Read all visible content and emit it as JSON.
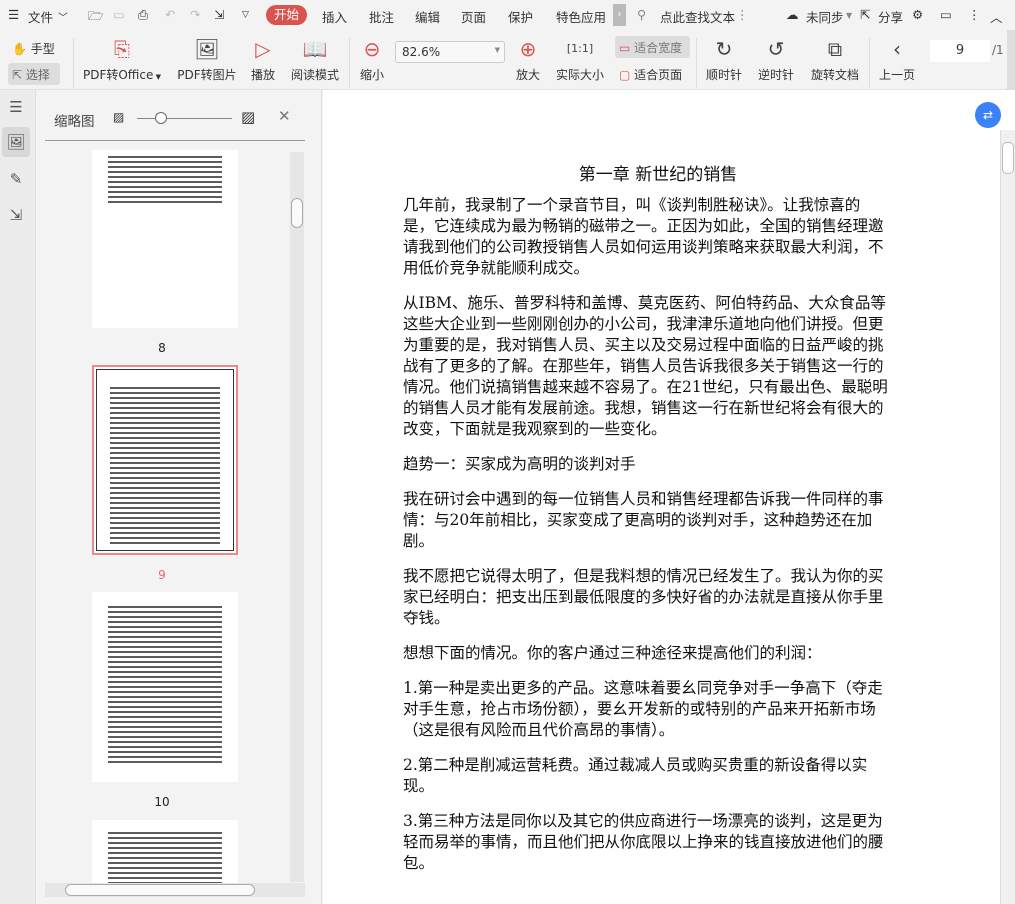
{
  "menubar": {
    "file": "文件",
    "tabs": [
      "开始",
      "插入",
      "批注",
      "编辑",
      "页面",
      "保护",
      "特色应用"
    ],
    "search_placeholder": "点此查找文本",
    "sync": "未同步",
    "share": "分享"
  },
  "toolbar": {
    "hand": "手型",
    "select": "选择",
    "pdf_to_office": "PDF转Office",
    "pdf_to_image": "PDF转图片",
    "play": "播放",
    "read_mode": "阅读模式",
    "zoom_out": "缩小",
    "zoom_value": "82.6%",
    "zoom_in": "放大",
    "actual_size": "实际大小",
    "fit_width": "适合宽度",
    "fit_page": "适合页面",
    "clockwise": "顺时针",
    "counter_clockwise": "逆时针",
    "rotate_doc": "旋转文档",
    "prev_page": "上一页",
    "page_current": "9",
    "page_total": "/1"
  },
  "sidebar": {
    "title": "缩略图",
    "thumbnails": [
      {
        "label": "8"
      },
      {
        "label": "9",
        "selected": true
      },
      {
        "label": "10"
      }
    ]
  },
  "document": {
    "title": "第一章 新世纪的销售",
    "paragraphs": [
      [
        "几年前，我录制了一个录音节目，叫《谈判制胜秘诀》。让我惊喜的",
        "是，它连续成为最为畅销的磁带之一。正因为如此，全国的销售经理邀",
        "请我到他们的公司教授销售人员如何运用谈判策略来获取最大利润，不",
        "用低价竞争就能顺利成交。"
      ],
      [
        "从IBM、施乐、普罗科特和盖博、莫克医药、阿伯特药品、大众食品等",
        "这些大企业到一些刚刚创办的小公司，我津津乐道地向他们讲授。但更",
        "为重要的是，我对销售人员、买主以及交易过程中面临的日益严峻的挑",
        "战有了更多的了解。在那些年，销售人员告诉我很多关于销售这一行的",
        "情况。他们说搞销售越来越不容易了。在21世纪，只有最出色、最聪明",
        "的销售人员才能有发展前途。我想，销售这一行在新世纪将会有很大的",
        "改变，下面就是我观察到的一些变化。"
      ],
      [
        "趋势一：买家成为高明的谈判对手"
      ],
      [
        "我在研讨会中遇到的每一位销售人员和销售经理都告诉我一件同样的事",
        "情：与20年前相比，买家变成了更高明的谈判对手，这种趋势还在加",
        "剧。"
      ],
      [
        "我不愿把它说得太明了，但是我料想的情况已经发生了。我认为你的买",
        "家已经明白：把支出压到最低限度的多快好省的办法就是直接从你手里",
        "夺钱。"
      ],
      [
        "想想下面的情况。你的客户通过三种途径来提高他们的利润："
      ],
      [
        "1.第一种是卖出更多的产品。这意味着要幺同竞争对手一争高下（夺走",
        "对手生意，抢占市场份额），要幺开发新的或特别的产品来开拓新市场",
        "（这是很有风险而且代价高昂的事情）。"
      ],
      [
        "2.第二种是削减运营耗费。通过裁减人员或购买贵重的新设备得以实",
        "现。"
      ],
      [
        "3.第三种方法是同你以及其它的供应商进行一场漂亮的谈判，这是更为",
        "轻而易举的事情，而且他们把从你底限以上挣来的钱直接放进他们的腰",
        "包。"
      ]
    ]
  }
}
